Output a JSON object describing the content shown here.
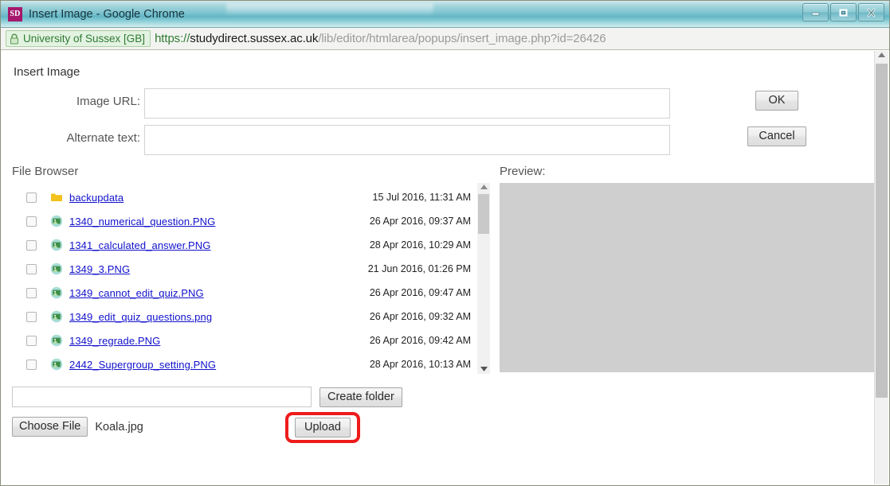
{
  "window": {
    "favicon_label": "SD",
    "title": "Insert Image - Google Chrome",
    "minimize_label": "Minimize",
    "maximize_label": "Maximize",
    "close_label": "Close"
  },
  "address_bar": {
    "ev_badge_text": "University of Sussex [GB]",
    "lock_icon": "lock-icon",
    "url_scheme": "https://",
    "url_host": "studydirect.sussex.ac.uk",
    "url_path": "/lib/editor/htmlarea/popups/insert_image.php?id=26426"
  },
  "form": {
    "heading": "Insert Image",
    "image_url_label": "Image URL:",
    "image_url_value": "",
    "image_url_placeholder": "",
    "alternate_text_label": "Alternate text:",
    "alternate_text_value": "",
    "alternate_text_placeholder": "",
    "ok_label": "OK",
    "cancel_label": "Cancel"
  },
  "file_browser": {
    "title": "File Browser",
    "files": [
      {
        "name": "backupdata",
        "date": "15 Jul 2016, 11:31 AM",
        "icon": "folder-icon",
        "checked": false
      },
      {
        "name": "1340_numerical_question.PNG",
        "date": "26 Apr 2016, 09:37 AM",
        "icon": "image-file-icon",
        "checked": false
      },
      {
        "name": "1341_calculated_answer.PNG",
        "date": "28 Apr 2016, 10:29 AM",
        "icon": "image-file-icon",
        "checked": false
      },
      {
        "name": "1349_3.PNG",
        "date": "21 Jun 2016, 01:26 PM",
        "icon": "image-file-icon",
        "checked": false
      },
      {
        "name": "1349_cannot_edit_quiz.PNG",
        "date": "26 Apr 2016, 09:47 AM",
        "icon": "image-file-icon",
        "checked": false
      },
      {
        "name": "1349_edit_quiz_questions.png",
        "date": "26 Apr 2016, 09:32 AM",
        "icon": "image-file-icon",
        "checked": false
      },
      {
        "name": "1349_regrade.PNG",
        "date": "26 Apr 2016, 09:42 AM",
        "icon": "image-file-icon",
        "checked": false
      },
      {
        "name": "2442_Supergroup_setting.PNG",
        "date": "28 Apr 2016, 10:13 AM",
        "icon": "image-file-icon",
        "checked": false
      }
    ]
  },
  "preview": {
    "title": "Preview:",
    "content": ""
  },
  "bottom": {
    "folder_name_value": "",
    "folder_name_placeholder": "",
    "create_folder_label": "Create folder",
    "choose_file_label": "Choose File",
    "chosen_file_name": "Koala.jpg",
    "upload_label": "Upload"
  },
  "colors": {
    "titlebar_accent": "#63b6c6",
    "favicon_bg": "#a5186b",
    "ev_green": "#2f7a33",
    "link_blue": "#1111cc",
    "highlight_red": "#ee1b1b",
    "preview_bg": "#cfcfcf"
  }
}
